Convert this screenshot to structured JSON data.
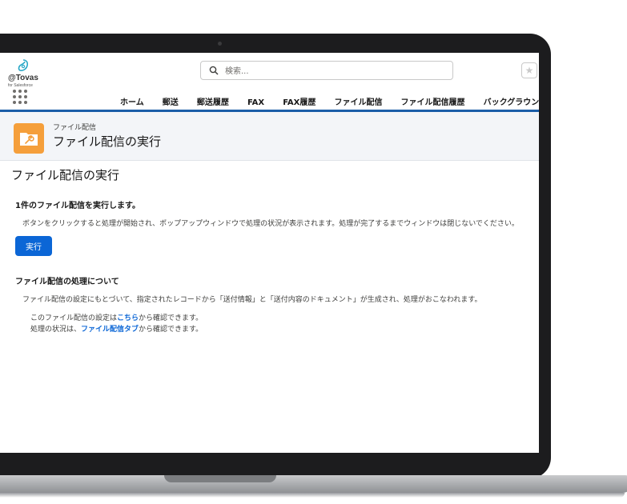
{
  "header": {
    "logo_text": "@Tovas",
    "logo_sub": "for Salesforce",
    "search_placeholder": "検索...",
    "fav_icon": "star-icon",
    "nav_items": [
      "ホーム",
      "郵送",
      "郵送履歴",
      "FAX",
      "FAX履歴",
      "ファイル配信",
      "ファイル配信履歴",
      "バックグラウンド処"
    ]
  },
  "page": {
    "eyebrow": "ファイル配信",
    "title": "ファイル配信の実行",
    "icon": "folder-wrench-icon"
  },
  "content": {
    "title": "ファイル配信の実行",
    "section1_title": "1件のファイル配信を実行します。",
    "section1_desc": "ボタンをクリックすると処理が開始され、ポップアップウィンドウで処理の状況が表示されます。処理が完了するまでウィンドウは閉じないでください。",
    "run_button": "実行",
    "section2_title": "ファイル配信の処理について",
    "section2_desc": "ファイル配信の設定にもとづいて、指定されたレコードから「送付情報」と「送付内容のドキュメント」が生成され、処理がおこなわれます。",
    "line3_before": "このファイル配信の設定は",
    "line3_link": "こちら",
    "line3_after": "から確認できます。",
    "line4_before": "処理の状況は、",
    "line4_link": "ファイル配信タブ",
    "line4_after": "から確認できます。"
  },
  "colors": {
    "brand_blue": "#0b66d6",
    "header_line": "#1b5ea8",
    "page_icon": "#f59f3b"
  }
}
